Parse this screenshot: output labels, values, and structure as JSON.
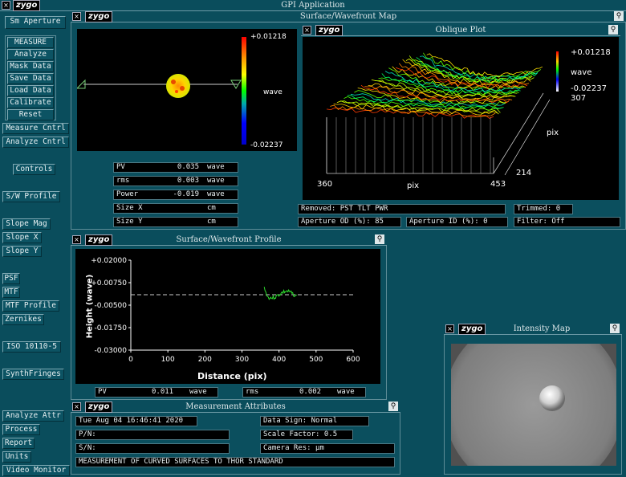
{
  "app": {
    "title": "GPI Application",
    "logo": "zygo"
  },
  "sidebar": {
    "aperture": "Sm Aperture",
    "main_buttons": [
      "MEASURE",
      "Analyze",
      "Mask Data",
      "Save Data",
      "Load Data",
      "Calibrate",
      "Reset"
    ],
    "measure_cntrl": "Measure Cntrl",
    "analyze_cntrl": "Analyze Cntrl",
    "controls": "Controls",
    "sw_profile": "S/W Profile",
    "slope_mag": "Slope Mag",
    "slope_x": "Slope X",
    "slope_y": "Slope Y",
    "psf": "PSF",
    "mtf": "MTF",
    "mtf_profile": "MTF Profile",
    "zernikes": "Zernikes",
    "iso": "ISO 10110-5",
    "synth": "SynthFringes",
    "analyze_attr": "Analyze Attr",
    "process": "Process",
    "report": "Report",
    "units": "Units",
    "video_monitor": "Video Monitor"
  },
  "surface_map": {
    "title": "Surface/Wavefront Map",
    "scale_max": "+0.01218",
    "scale_unit": "wave",
    "scale_min": "-0.02237",
    "stats": [
      {
        "label": "PV",
        "value": "0.035",
        "unit": "wave"
      },
      {
        "label": "rms",
        "value": "0.003",
        "unit": "wave"
      },
      {
        "label": "Power",
        "value": "-0.019",
        "unit": "wave"
      },
      {
        "label": "Size X",
        "value": "",
        "unit": "cm"
      },
      {
        "label": "Size Y",
        "value": "",
        "unit": "cm"
      }
    ]
  },
  "oblique": {
    "title": "Oblique Plot",
    "scale_max": "+0.01218",
    "scale_unit": "wave",
    "scale_min": "-0.02237",
    "y_top": "307",
    "y_label": "pix",
    "y_bottom": "214",
    "x_left": "360",
    "x_label": "pix",
    "x_right": "453"
  },
  "info": {
    "removed": "Removed: PST TLT PWR",
    "trimmed": "Trimmed:  0",
    "aperture_od": "Aperture OD (%):  85",
    "aperture_id": "Aperture ID (%):  0",
    "filter": "Filter:        Off"
  },
  "profile": {
    "title": "Surface/Wavefront Profile",
    "ylabel": "Height (wave)",
    "xlabel": "Distance (pix)",
    "yticks": [
      "+0.02000",
      "+0.00750",
      "-0.00500",
      "-0.01750",
      "-0.03000"
    ],
    "xticks": [
      "0",
      "100",
      "200",
      "300",
      "400",
      "500",
      "600"
    ],
    "pv": {
      "label": "PV",
      "value": "0.011",
      "unit": "wave"
    },
    "rms": {
      "label": "rms",
      "value": "0.002",
      "unit": "wave"
    }
  },
  "intensity": {
    "title": "Intensity Map"
  },
  "attributes": {
    "title": "Measurement Attributes",
    "date": "Tue Aug 04 16:46:41 2020",
    "pn": "P/N:",
    "sn": "S/N:",
    "data_sign": "Data Sign:    Normal",
    "scale_factor": "Scale Factor:  0.5",
    "camera_res": "Camera Res:              µm",
    "comment": "MEASUREMENT OF CURVED SURFACES TO THOR STANDARD"
  },
  "icons": {
    "close": "close-icon",
    "pin": "pin-icon"
  }
}
